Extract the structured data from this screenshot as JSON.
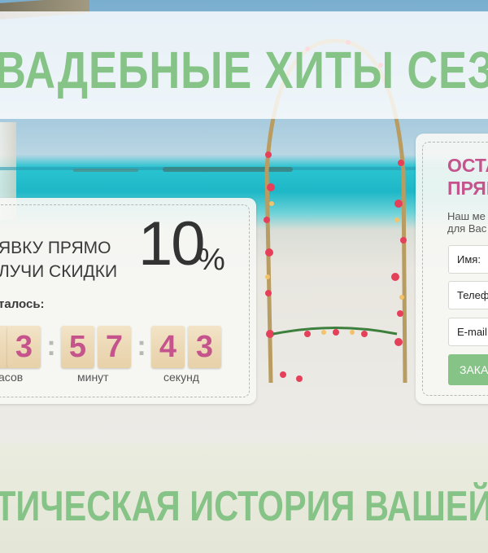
{
  "header": {
    "title": "ВАДЕБНЫЕ ХИТЫ СЕЗО"
  },
  "promo": {
    "line1": "ЯВКУ ПРЯМО",
    "line2": "ЛУЧИ СКИДКИ",
    "percent": "10",
    "percent_sign": "%",
    "remaining_label": "талось:"
  },
  "countdown": {
    "digits": [
      "3",
      "5",
      "7",
      "4",
      "3"
    ],
    "separator": ":",
    "units": {
      "hours": "асов",
      "minutes": "минут",
      "seconds": "секунд"
    }
  },
  "form": {
    "title_line1": "ОСТА",
    "title_line2": "ПРЯМ",
    "desc_line1": "Наш ме",
    "desc_line2": "для Вас",
    "name_label": "Имя:",
    "phone_label": "Телеф",
    "email_label": "E-mail:",
    "submit_label": "ЗАКА"
  },
  "bottom": {
    "story": "ТИЧЕСКАЯ ИСТОРИЯ ВАШЕЙ С"
  },
  "colors": {
    "accent_green": "#86c387",
    "accent_pink": "#c4548b",
    "digit_tile": "#ecd9b6"
  }
}
